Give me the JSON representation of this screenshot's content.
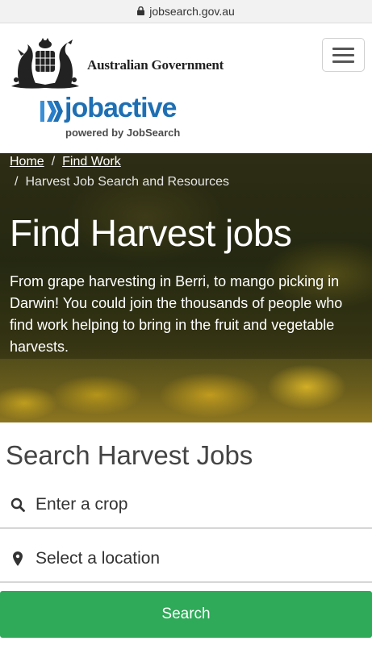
{
  "browser": {
    "url": "jobsearch.gov.au"
  },
  "header": {
    "gov_name": "Australian Government",
    "brand_name": "jobactive",
    "brand_tagline": "powered by JobSearch"
  },
  "breadcrumb": {
    "items": [
      "Home",
      "Find Work"
    ],
    "separator": "/",
    "current": "Harvest Job Search and Resources"
  },
  "hero": {
    "title": "Find Harvest jobs",
    "description": "From grape harvesting in Berri, to mango picking in Darwin! You could join the thousands of people who find work helping to bring in the fruit and vegetable harvests."
  },
  "search": {
    "title": "Search Harvest Jobs",
    "crop_placeholder": "Enter a crop",
    "location_placeholder": "Select a location",
    "button_label": "Search"
  },
  "colors": {
    "brand_blue": "#1e6fb3",
    "search_green": "#2eaa58"
  },
  "icons": [
    "lock-icon",
    "menu-icon",
    "search-icon",
    "location-pin-icon",
    "coat-of-arms-icon",
    "jobactive-mark-icon"
  ]
}
